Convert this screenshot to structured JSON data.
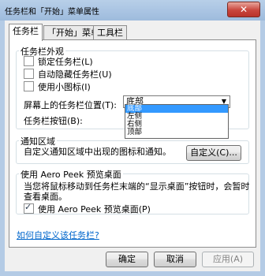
{
  "window": {
    "title": "任务栏和「开始」菜单属性",
    "close_glyph": "✕"
  },
  "tabs": [
    {
      "label": "任务栏"
    },
    {
      "label": "「开始」菜单"
    },
    {
      "label": "工具栏"
    }
  ],
  "appearance": {
    "legend": "任务栏外观",
    "lock": "锁定任务栏(L)",
    "autohide": "自动隐藏任务栏(U)",
    "small_icons": "使用小图标(I)",
    "location_label": "屏幕上的任务栏位置(T):",
    "location_value": "底部",
    "location_options": [
      "底部",
      "左侧",
      "右侧",
      "顶部"
    ],
    "buttons_label": "任务栏按钮(B):"
  },
  "notification": {
    "legend": "通知区域",
    "desc": "自定义通知区域中出现的图标和通知。",
    "customize": "自定义(C)..."
  },
  "aero_peek": {
    "legend": "使用 Aero Peek 预览桌面",
    "desc_line1": "当您将鼠标移动到任务栏末端的“显示桌面”按钮时，会暂时",
    "desc_line2": "查看桌面。",
    "checkbox": "使用 Aero Peek 预览桌面(P)"
  },
  "link": "如何自定义该任务栏?",
  "footer": {
    "ok": "确定",
    "cancel": "取消",
    "apply": "应用(A)"
  },
  "colors": {
    "selection": "#3399ff",
    "link": "#0066cc"
  }
}
